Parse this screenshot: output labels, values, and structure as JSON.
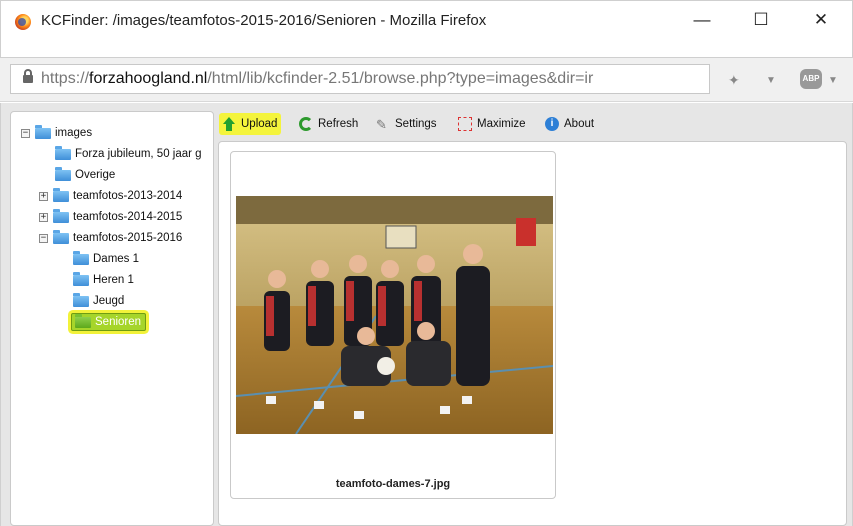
{
  "window": {
    "title": "KCFinder: /images/teamfotos-2015-2016/Senioren - Mozilla Firefox",
    "minimize": "—",
    "maximize": "☐",
    "close": "✕"
  },
  "browser": {
    "url_prefix": "https://",
    "url_host": "forzahoogland.nl",
    "url_rest": "/html/lib/kcfinder-2.51/browse.php?type=images&dir=ir",
    "icons": [
      "lock-icon",
      "extension-icon",
      "dropdown-icon",
      "adblock-icon"
    ],
    "abp_label": "ABP"
  },
  "toolbar": {
    "upload": "Upload",
    "refresh": "Refresh",
    "settings": "Settings",
    "maximize": "Maximize",
    "about": "About"
  },
  "tree": {
    "root": "images",
    "items": [
      {
        "label": "Forza jubileum, 50 jaar g"
      },
      {
        "label": "Overige"
      },
      {
        "label": "teamfotos-2013-2014",
        "expander": "+"
      },
      {
        "label": "teamfotos-2014-2015",
        "expander": "+"
      },
      {
        "label": "teamfotos-2015-2016",
        "expander": "−"
      },
      {
        "label": "Dames 1"
      },
      {
        "label": "Heren 1"
      },
      {
        "label": "Jeugd"
      },
      {
        "label": "Senioren",
        "selected": true
      }
    ],
    "root_expander": "−"
  },
  "files": [
    {
      "name": "teamfoto-dames-7.jpg"
    }
  ],
  "colors": {
    "highlight": "#f4f43c",
    "selected_folder": "#a6d52a",
    "folder": "#3f8fd8"
  }
}
